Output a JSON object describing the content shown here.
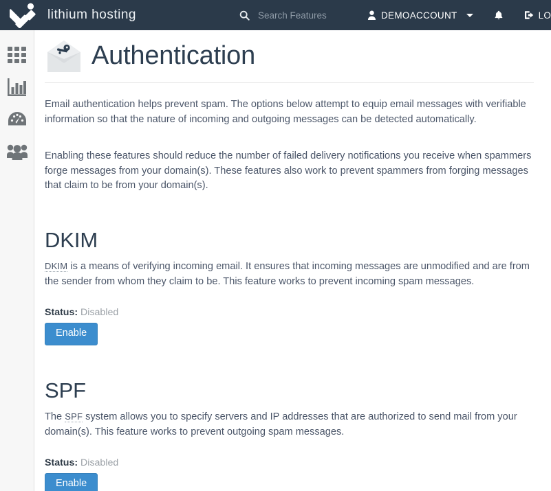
{
  "header": {
    "brand_name": "lithium hosting",
    "logo_icon": "lithium-logo-icon",
    "search": {
      "icon": "search-icon",
      "placeholder": "Search Features",
      "value": ""
    },
    "account": {
      "icon": "user-icon",
      "label": "DEMOACCOUNT",
      "caret": "chevron-down-icon"
    },
    "notifications": {
      "icon": "bell-icon"
    },
    "logout": {
      "icon": "sign-out-icon",
      "label": "LOGOUT"
    }
  },
  "sidebar": {
    "items": [
      {
        "name": "sidebar-item-apps",
        "icon": "grid-icon"
      },
      {
        "name": "sidebar-item-statistics",
        "icon": "bar-chart-icon"
      },
      {
        "name": "sidebar-item-dashboard",
        "icon": "gauge-icon"
      },
      {
        "name": "sidebar-item-users",
        "icon": "people-icon"
      }
    ]
  },
  "page": {
    "icon": "envelope-key-icon",
    "title": "Authentication",
    "intro_1": "Email authentication helps prevent spam. The options below attempt to equip email messages with verifiable information so that the nature of incoming and outgoing messages can be detected automatically.",
    "intro_2": "Enabling these features should reduce the number of failed delivery notifications you receive when spammers forge messages from your domain(s). These features also work to prevent spammers from forging messages that claim to be from your domain(s)."
  },
  "dkim": {
    "title": "DKIM",
    "abbr": "DKIM",
    "desc_rest": " is a means of verifying incoming email. It ensures that incoming messages are unmodified and are from the sender from whom they claim to be. This feature works to prevent incoming spam messages.",
    "status_label": "Status:",
    "status_value": "Disabled",
    "button_label": "Enable"
  },
  "spf": {
    "title": "SPF",
    "desc_before": "The ",
    "abbr": "SPF",
    "desc_rest": " system allows you to specify servers and IP addresses that are authorized to send mail from your domain(s). This feature works to prevent outgoing spam messages.",
    "status_label": "Status:",
    "status_value": "Disabled",
    "button_label": "Enable"
  },
  "colors": {
    "header_bg": "#2b3a4a",
    "sidebar_bg": "#f7f7f7",
    "accent_button": "#3c8dce",
    "heading_text": "#2d3e50",
    "body_text": "#4a5568",
    "muted_text": "#9aa0a6"
  }
}
